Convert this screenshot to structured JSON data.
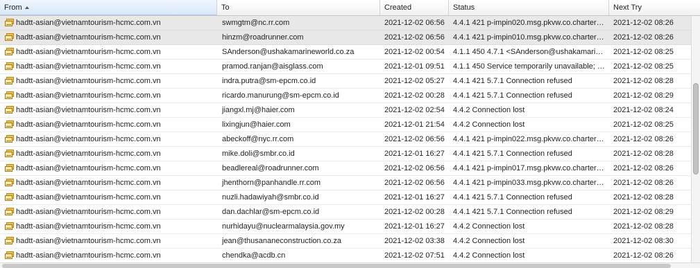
{
  "columns": {
    "from": "From",
    "to": "To",
    "created": "Created",
    "status": "Status",
    "next_try": "Next Try"
  },
  "icons": {
    "row_icon": "mail-envelopes-icon",
    "sort_icon": "sort-ascending-arrow-icon"
  },
  "rows": [
    {
      "from": "hadtt-asian@vietnamtourism-hcmc.com.vn",
      "to": "swmgtm@nc.rr.com",
      "created": "2021-12-02 06:56",
      "status": "4.4.1 421 p-impin020.msg.pkvw.co.charter…",
      "next_try": "2021-12-02 08:26",
      "selected": true
    },
    {
      "from": "hadtt-asian@vietnamtourism-hcmc.com.vn",
      "to": "hinzm@roadrunner.com",
      "created": "2021-12-02 06:56",
      "status": "4.4.1 421 p-impin010.msg.pkvw.co.charter…",
      "next_try": "2021-12-02 08:26",
      "selected": true
    },
    {
      "from": "hadtt-asian@vietnamtourism-hcmc.com.vn",
      "to": "SAnderson@ushakamarineworld.co.za",
      "created": "2021-12-02 00:54",
      "status": "4.1.1 450 4.7.1 <SAnderson@ushakamari…",
      "next_try": "2021-12-02 08:25",
      "selected": false
    },
    {
      "from": "hadtt-asian@vietnamtourism-hcmc.com.vn",
      "to": "pramod.ranjan@aisglass.com",
      "created": "2021-12-01 09:51",
      "status": "4.1.1 450 Service temporarily unavailable; …",
      "next_try": "2021-12-02 08:25",
      "selected": false
    },
    {
      "from": "hadtt-asian@vietnamtourism-hcmc.com.vn",
      "to": "indra.putra@sm-epcm.co.id",
      "created": "2021-12-02 05:27",
      "status": "4.4.1 421 5.7.1 Connection refused",
      "next_try": "2021-12-02 08:28",
      "selected": false
    },
    {
      "from": "hadtt-asian@vietnamtourism-hcmc.com.vn",
      "to": "ricardo.manurung@sm-epcm.co.id",
      "created": "2021-12-02 00:28",
      "status": "4.4.1 421 5.7.1 Connection refused",
      "next_try": "2021-12-02 08:29",
      "selected": false
    },
    {
      "from": "hadtt-asian@vietnamtourism-hcmc.com.vn",
      "to": "jiangxl.mj@haier.com",
      "created": "2021-12-02 02:54",
      "status": "4.4.2 Connection lost",
      "next_try": "2021-12-02 08:24",
      "selected": false
    },
    {
      "from": "hadtt-asian@vietnamtourism-hcmc.com.vn",
      "to": "lixingjun@haier.com",
      "created": "2021-12-01 21:54",
      "status": "4.4.2 Connection lost",
      "next_try": "2021-12-02 08:25",
      "selected": false
    },
    {
      "from": "hadtt-asian@vietnamtourism-hcmc.com.vn",
      "to": "abeckoff@nyc.rr.com",
      "created": "2021-12-02 06:56",
      "status": "4.4.1 421 p-impin022.msg.pkvw.co.charter…",
      "next_try": "2021-12-02 08:26",
      "selected": false
    },
    {
      "from": "hadtt-asian@vietnamtourism-hcmc.com.vn",
      "to": "mike.doli@smbr.co.id",
      "created": "2021-12-01 16:27",
      "status": "4.4.1 421 5.7.1 Connection refused",
      "next_try": "2021-12-02 08:28",
      "selected": false
    },
    {
      "from": "hadtt-asian@vietnamtourism-hcmc.com.vn",
      "to": "beadlereal@roadrunner.com",
      "created": "2021-12-02 06:56",
      "status": "4.4.1 421 p-impin017.msg.pkvw.co.charter…",
      "next_try": "2021-12-02 08:26",
      "selected": false
    },
    {
      "from": "hadtt-asian@vietnamtourism-hcmc.com.vn",
      "to": "jhenthorn@panhandle.rr.com",
      "created": "2021-12-02 06:56",
      "status": "4.4.1 421 p-impin033.msg.pkvw.co.charter…",
      "next_try": "2021-12-02 08:26",
      "selected": false
    },
    {
      "from": "hadtt-asian@vietnamtourism-hcmc.com.vn",
      "to": "nuzli.hadawiyah@smbr.co.id",
      "created": "2021-12-01 16:27",
      "status": "4.4.1 421 5.7.1 Connection refused",
      "next_try": "2021-12-02 08:28",
      "selected": false
    },
    {
      "from": "hadtt-asian@vietnamtourism-hcmc.com.vn",
      "to": "dan.dachlar@sm-epcm.co.id",
      "created": "2021-12-02 00:28",
      "status": "4.4.1 421 5.7.1 Connection refused",
      "next_try": "2021-12-02 08:29",
      "selected": false
    },
    {
      "from": "hadtt-asian@vietnamtourism-hcmc.com.vn",
      "to": "nurhidayu@nuclearmalaysia.gov.my",
      "created": "2021-12-01 16:27",
      "status": "4.4.2 Connection lost",
      "next_try": "2021-12-02 08:28",
      "selected": false
    },
    {
      "from": "hadtt-asian@vietnamtourism-hcmc.com.vn",
      "to": "jean@thusananeconstruction.co.za",
      "created": "2021-12-02 03:38",
      "status": "4.4.2 Connection lost",
      "next_try": "2021-12-02 08:30",
      "selected": false
    },
    {
      "from": "hadtt-asian@vietnamtourism-hcmc.com.vn",
      "to": "chendka@acdb.cn",
      "created": "2021-12-02 07:51",
      "status": "4.4.2 Connection lost",
      "next_try": "2021-12-02 08:26",
      "selected": false
    }
  ]
}
